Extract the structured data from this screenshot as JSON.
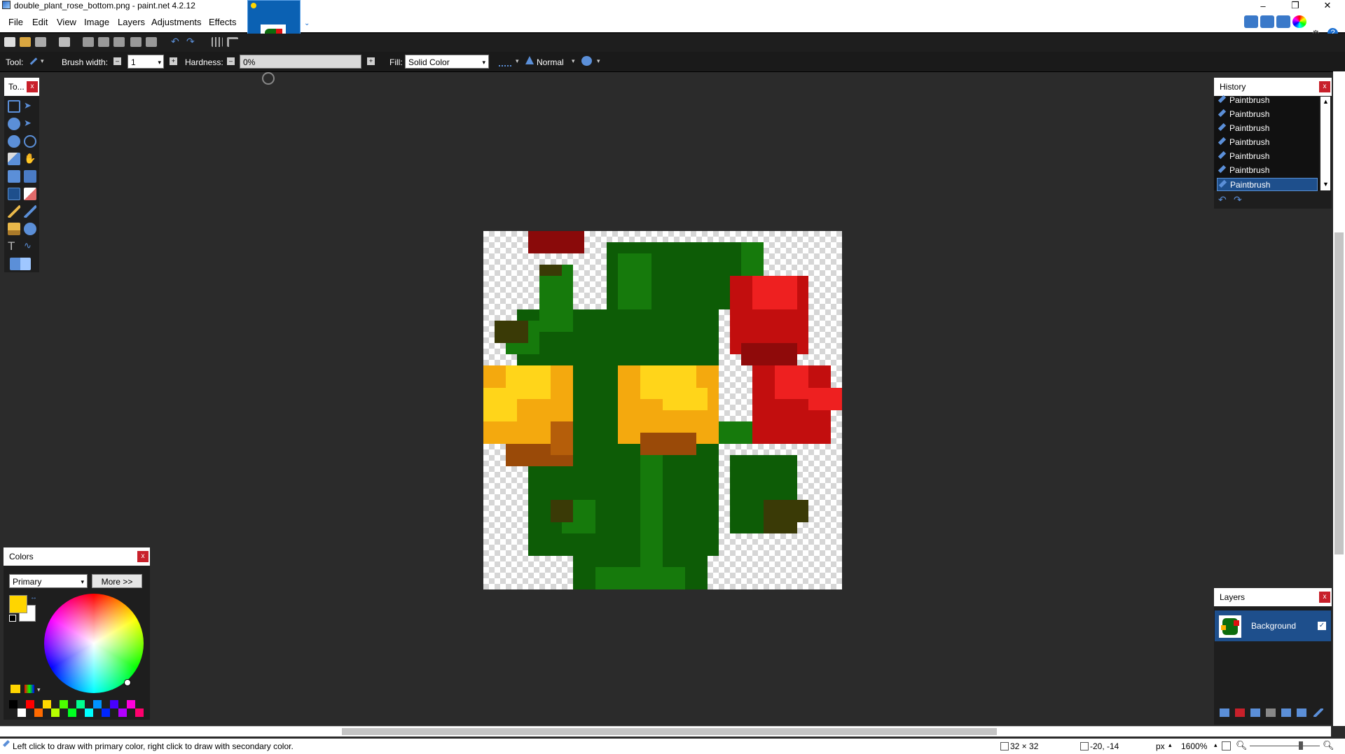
{
  "titlebar": {
    "title": "double_plant_rose_bottom.png - paint.net 4.2.12",
    "minimize": "–",
    "restore": "❐",
    "close": "✕"
  },
  "menu": {
    "items": [
      "File",
      "Edit",
      "View",
      "Image",
      "Layers",
      "Adjustments",
      "Effects"
    ]
  },
  "tool_options": {
    "tool_label": "Tool:",
    "brush_width_label": "Brush width:",
    "brush_width_value": "1",
    "hardness_label": "Hardness:",
    "hardness_value": "0%",
    "fill_label": "Fill:",
    "fill_value": "Solid Color",
    "blend_mode": "Normal"
  },
  "tools_panel": {
    "title": "To...",
    "close": "x"
  },
  "history_panel": {
    "title": "History",
    "close": "x",
    "items": [
      "Paintbrush",
      "Paintbrush",
      "Paintbrush",
      "Paintbrush",
      "Paintbrush",
      "Paintbrush",
      "Paintbrush"
    ],
    "selected_index": 6
  },
  "layers_panel": {
    "title": "Layers",
    "close": "x",
    "layers": [
      {
        "name": "Background",
        "visible": true
      }
    ]
  },
  "colors_panel": {
    "title": "Colors",
    "close": "x",
    "mode": "Primary",
    "more_button": "More >>",
    "primary_color": "#ffd500",
    "secondary_color": "#ffffff"
  },
  "status": {
    "hint": "Left click to draw with primary color, right click to draw with secondary color.",
    "image_size": "32 × 32",
    "cursor_pos": "-20, -14",
    "units": "px",
    "zoom": "1600%"
  },
  "palette": [
    "#000000",
    "#ffffff",
    "#ff0000",
    "#ff6a00",
    "#ffd800",
    "#b6ff00",
    "#4cff00",
    "#00ff21",
    "#00ff90",
    "#00ffff",
    "#0094ff",
    "#0026ff",
    "#4800ff",
    "#b200ff",
    "#ff00dc",
    "#ff006e"
  ]
}
